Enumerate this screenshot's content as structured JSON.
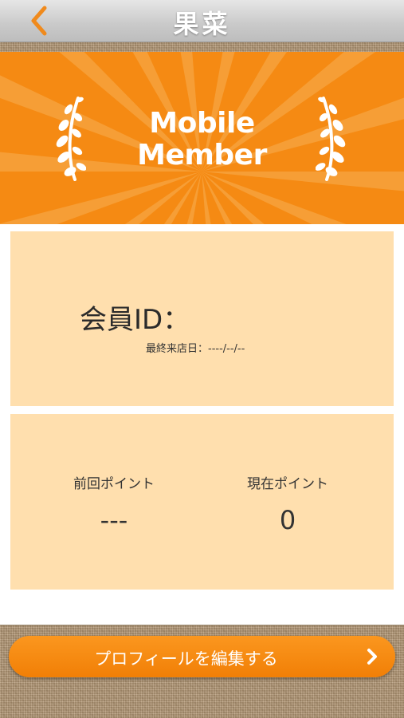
{
  "header": {
    "title": "果菜",
    "back_icon": "chevron-left-icon"
  },
  "hero": {
    "line1": "Mobile",
    "line2": "Member",
    "laurel_icon": "laurel-branch-icon"
  },
  "member": {
    "id_label": "会員ID：",
    "last_visit": "最終来店日：----/--/--"
  },
  "points": {
    "previous_label": "前回ポイント",
    "previous_value": "---",
    "current_label": "現在ポイント",
    "current_value": "0"
  },
  "actions": {
    "edit_profile_label": "プロフィールを編集する",
    "chevron_icon": "chevron-right-icon"
  },
  "colors": {
    "accent": "#f58a13",
    "card": "#ffdfae",
    "back_arrow": "#f08a1c"
  }
}
